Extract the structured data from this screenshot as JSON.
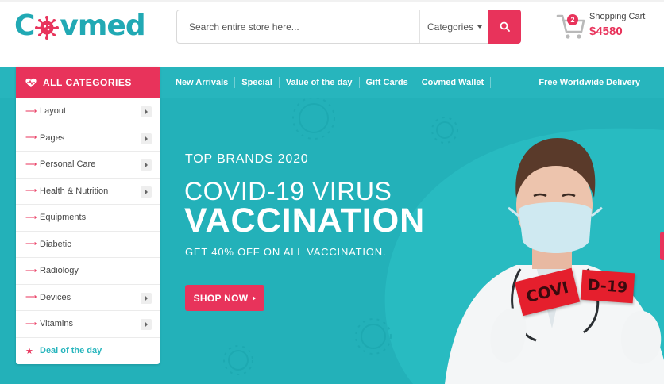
{
  "header": {
    "logo": {
      "prefix": "C",
      "suffix": "vmed",
      "brand_color": "#21a9b4",
      "accent_color": "#e8335b"
    },
    "search": {
      "placeholder": "Search entire store here...",
      "category_label": "Categories"
    },
    "cart": {
      "label": "Shopping Cart",
      "total": "$4580",
      "count": "2"
    }
  },
  "nav": {
    "links": [
      "New Arrivals",
      "Special",
      "Value of the day",
      "Gift Cards",
      "Covmed Wallet"
    ],
    "delivery": "Free Worldwide Delivery"
  },
  "categories": {
    "title": "ALL CATEGORIES",
    "items": [
      {
        "label": "Layout",
        "has_submenu": true
      },
      {
        "label": "Pages",
        "has_submenu": true
      },
      {
        "label": "Personal Care",
        "has_submenu": true
      },
      {
        "label": "Health & Nutrition",
        "has_submenu": true
      },
      {
        "label": "Equipments",
        "has_submenu": false
      },
      {
        "label": "Diabetic",
        "has_submenu": false
      },
      {
        "label": "Radiology",
        "has_submenu": false
      },
      {
        "label": "Devices",
        "has_submenu": true
      },
      {
        "label": "Vitamins",
        "has_submenu": true
      }
    ],
    "deal": "Deal of the day"
  },
  "hero": {
    "subtitle": "TOP BRANDS 2020",
    "title_line1": "COVID-19 VIRUS",
    "title_line2": "VACCINATION",
    "offer": "GET 40% OFF ON ALL VACCINATION.",
    "button": "SHOP NOW",
    "sign_left": "COVI",
    "sign_right": "D-19"
  },
  "colors": {
    "teal": "#27b5bd",
    "pink": "#e8335b"
  }
}
